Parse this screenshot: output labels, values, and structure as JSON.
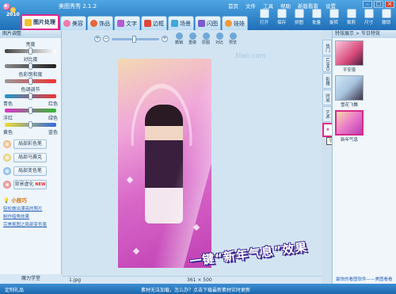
{
  "app": {
    "title": "美图秀秀 2.1.2",
    "year_badge": "2010"
  },
  "menu": [
    "首页",
    "文件",
    "工具",
    "帮助",
    "新版看看",
    "设置"
  ],
  "tabs": [
    {
      "label": "图片处理",
      "active": true,
      "color": "#f2c230"
    },
    {
      "label": "美容",
      "active": false,
      "color": "#f07aa8"
    },
    {
      "label": "饰品",
      "active": false,
      "color": "#e8643a"
    },
    {
      "label": "文字",
      "active": false,
      "color": "#b65bd0"
    },
    {
      "label": "边框",
      "active": false,
      "color": "#e0473a"
    },
    {
      "label": "场景",
      "active": false,
      "color": "#3fa7d9"
    },
    {
      "label": "闪图",
      "active": false,
      "color": "#7a5bd0"
    },
    {
      "label": "娃娃",
      "active": false,
      "color": "#f09a3a"
    }
  ],
  "toolbar": [
    "打开",
    "保存",
    "拼图",
    "批量",
    "旋转",
    "裁剪",
    "尺寸",
    "撤销"
  ],
  "left_panel": {
    "header": "图片调整",
    "sliders": [
      "亮度",
      "对比度",
      "色彩饱和度",
      "色调调节"
    ],
    "color_pairs": [
      [
        "青色",
        "红色"
      ],
      [
        "洋红",
        "绿色"
      ],
      [
        "黄色",
        "蓝色"
      ]
    ],
    "buttons": [
      {
        "label": "局部彩色笔",
        "new": false
      },
      {
        "label": "局部马赛克",
        "new": false
      },
      {
        "label": "局部变色笔",
        "new": false
      },
      {
        "label": "背景虚化",
        "new": true
      }
    ],
    "new_badge": "NEW",
    "tips_title": "小技巧",
    "tips": [
      "轻松做出漂亮的照片",
      "制作暗角效果",
      "完美抠图之局部变色笔"
    ],
    "footer": "魔力学堂"
  },
  "canvas": {
    "edit_buttons": [
      "撤销",
      "重做",
      "原图",
      "对比",
      "预览"
    ],
    "watermark": "3lian.com",
    "caption": "一键“新年气息”效果",
    "file_name": "1.jpg",
    "dimensions": "361 × 500"
  },
  "category_tabs": [
    "热门",
    "LOMO",
    "影楼",
    "时尚",
    "艺术"
  ],
  "category_tooltip": "节日特效",
  "right_panel": {
    "header": "特效展示 > 节日特效",
    "effects": [
      {
        "label": "平安夜",
        "selected": false
      },
      {
        "label": "雪花飞舞",
        "selected": false
      },
      {
        "label": "新年气息",
        "selected": true
      }
    ],
    "link": "最快的看图软件——美图看看"
  },
  "bottom_bar": {
    "left": "定制礼品",
    "middle": "素材无法加载，怎么办？点击下载最新素材实时更新"
  }
}
